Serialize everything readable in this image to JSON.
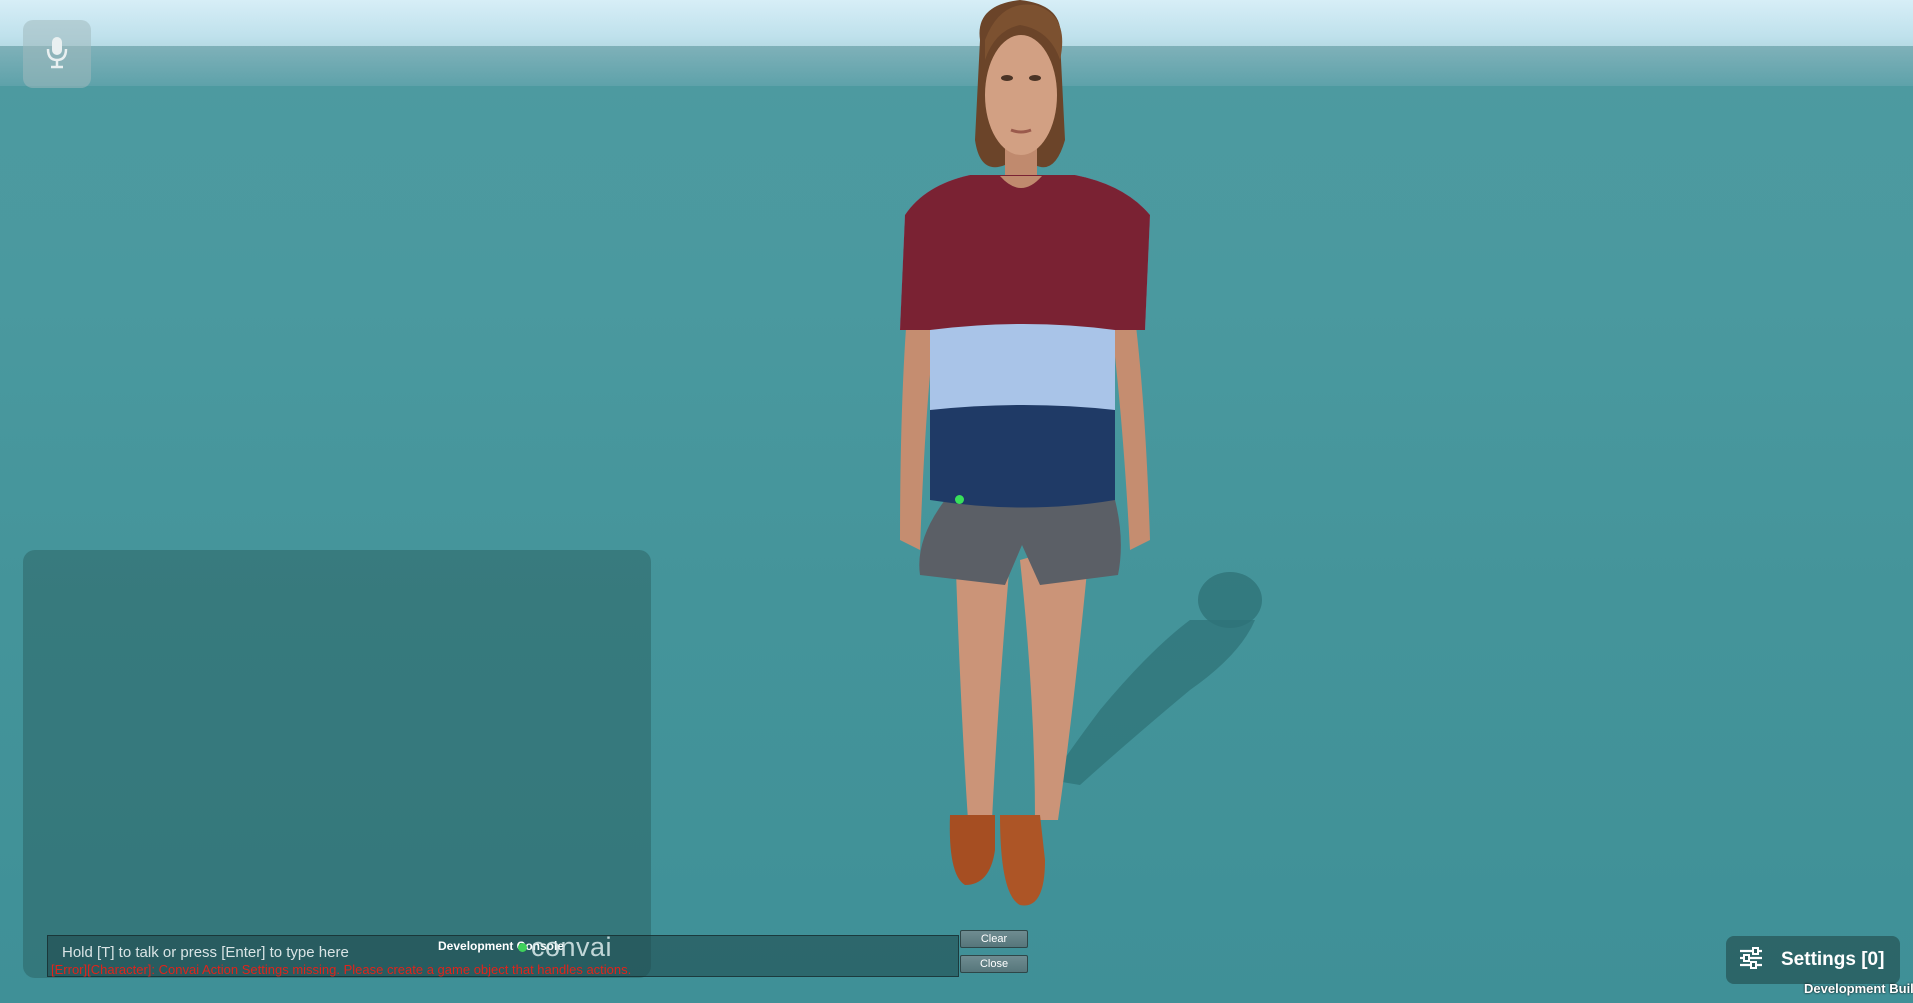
{
  "mic": {
    "icon": "microphone-icon"
  },
  "chat": {
    "placeholder": "Hold [T] to talk or press [Enter] to type here",
    "error_message": "[Error][Character]: Convai Action Settings missing. Please create a game object that handles actions."
  },
  "console": {
    "title": "Development Console",
    "clear_label": "Clear",
    "close_label": "Close"
  },
  "brand": {
    "logo_text": "convai",
    "dot_color": "#3fd25b"
  },
  "settings": {
    "label": "Settings [0]",
    "icon": "sliders-icon"
  },
  "build": {
    "label": "Development Build"
  },
  "colors": {
    "error": "#e2231a",
    "shirt_top": "#7a2233",
    "shirt_mid": "#a9c4e8",
    "shirt_bottom": "#1f3a66"
  }
}
